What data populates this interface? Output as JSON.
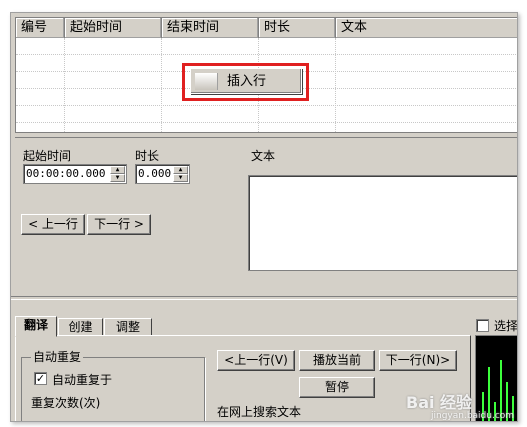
{
  "list": {
    "columns": [
      "编号",
      "起始时间",
      "结束时间",
      "时长",
      "文本"
    ]
  },
  "context_menu": {
    "insert_row": "插入行"
  },
  "editor": {
    "start_label": "起始时间",
    "start_value": "00:00:00.000",
    "duration_label": "时长",
    "duration_value": "0.000",
    "text_label": "文本",
    "prev_button": "< 上一行",
    "next_button": "下一行 >"
  },
  "tabs": [
    {
      "label": "翻译"
    },
    {
      "label": "创建"
    },
    {
      "label": "调整"
    }
  ],
  "translate_tab": {
    "auto_repeat_group": "自动重复",
    "auto_repeat_checkbox": "自动重复于",
    "repeat_count": "重复次数(次)",
    "prev_line": "<上一行(V)",
    "play_current": "播放当前",
    "next_line": "下一行(N)>",
    "pause": "暂停",
    "search_online": "在网上搜索文本",
    "select_checkbox": "选择"
  },
  "watermark": {
    "text": "Bai 经验",
    "url": "jingyan.baidu.com"
  },
  "colors": {
    "window_bg": "#d4d0c8",
    "highlight": "#e02020",
    "wave": "#3cff3c"
  }
}
